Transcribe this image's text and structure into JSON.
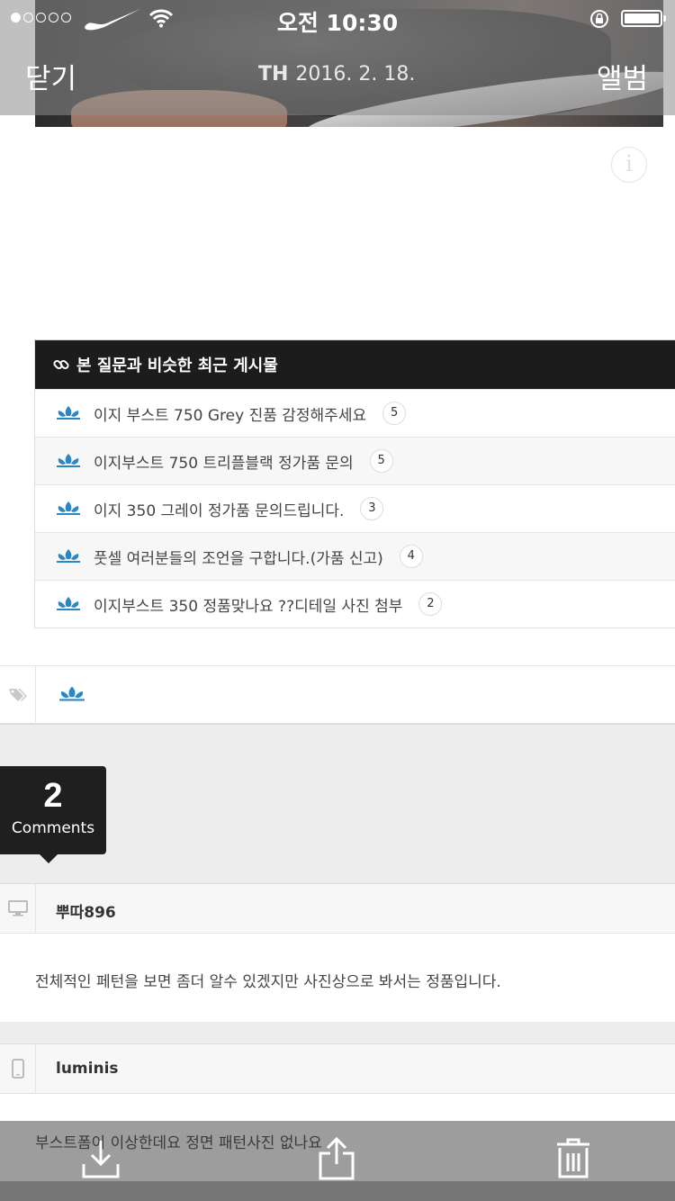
{
  "status_bar": {
    "time": "오전 10:30"
  },
  "nav": {
    "close_label": "닫기",
    "title_prefix": "TH",
    "title_date": "2016. 2. 18.",
    "album_label": "앨범"
  },
  "related": {
    "header": "본 질문과 비슷한 최근 게시물",
    "items": [
      {
        "title": "이지 부스트 750 Grey 진품 감정해주세요",
        "count": "5"
      },
      {
        "title": "이지부스트 750 트리플블랙 정가품 문의",
        "count": "5"
      },
      {
        "title": "이지 350 그레이 정가품 문의드립니다.",
        "count": "3"
      },
      {
        "title": "풋셀 여러분들의 조언을 구합니다.(가품 신고)",
        "count": "4"
      },
      {
        "title": "이지부스트 350 정품맞나요 ??디테일 사진 첨부",
        "count": "2"
      }
    ]
  },
  "comments": {
    "count": "2",
    "label": "Comments",
    "items": [
      {
        "author": "뿌따896",
        "device": "desktop",
        "text": "전체적인 페턴을 보면 좀더 알수 있겠지만 사진상으로 봐서는 정품입니다."
      },
      {
        "author": "luminis",
        "device": "mobile",
        "text": "부스트폼이 이상한데요 정면 패턴사진 없나요"
      }
    ]
  },
  "colors": {
    "adidas_blue": "#2b86c6",
    "header_dark": "#1c1c1c"
  },
  "icons": {
    "nav": [
      "nike-swoosh-icon",
      "wifi-icon",
      "rotation-lock-icon",
      "battery-icon"
    ],
    "toolbar": [
      "download-icon",
      "share-icon",
      "trash-icon"
    ]
  }
}
